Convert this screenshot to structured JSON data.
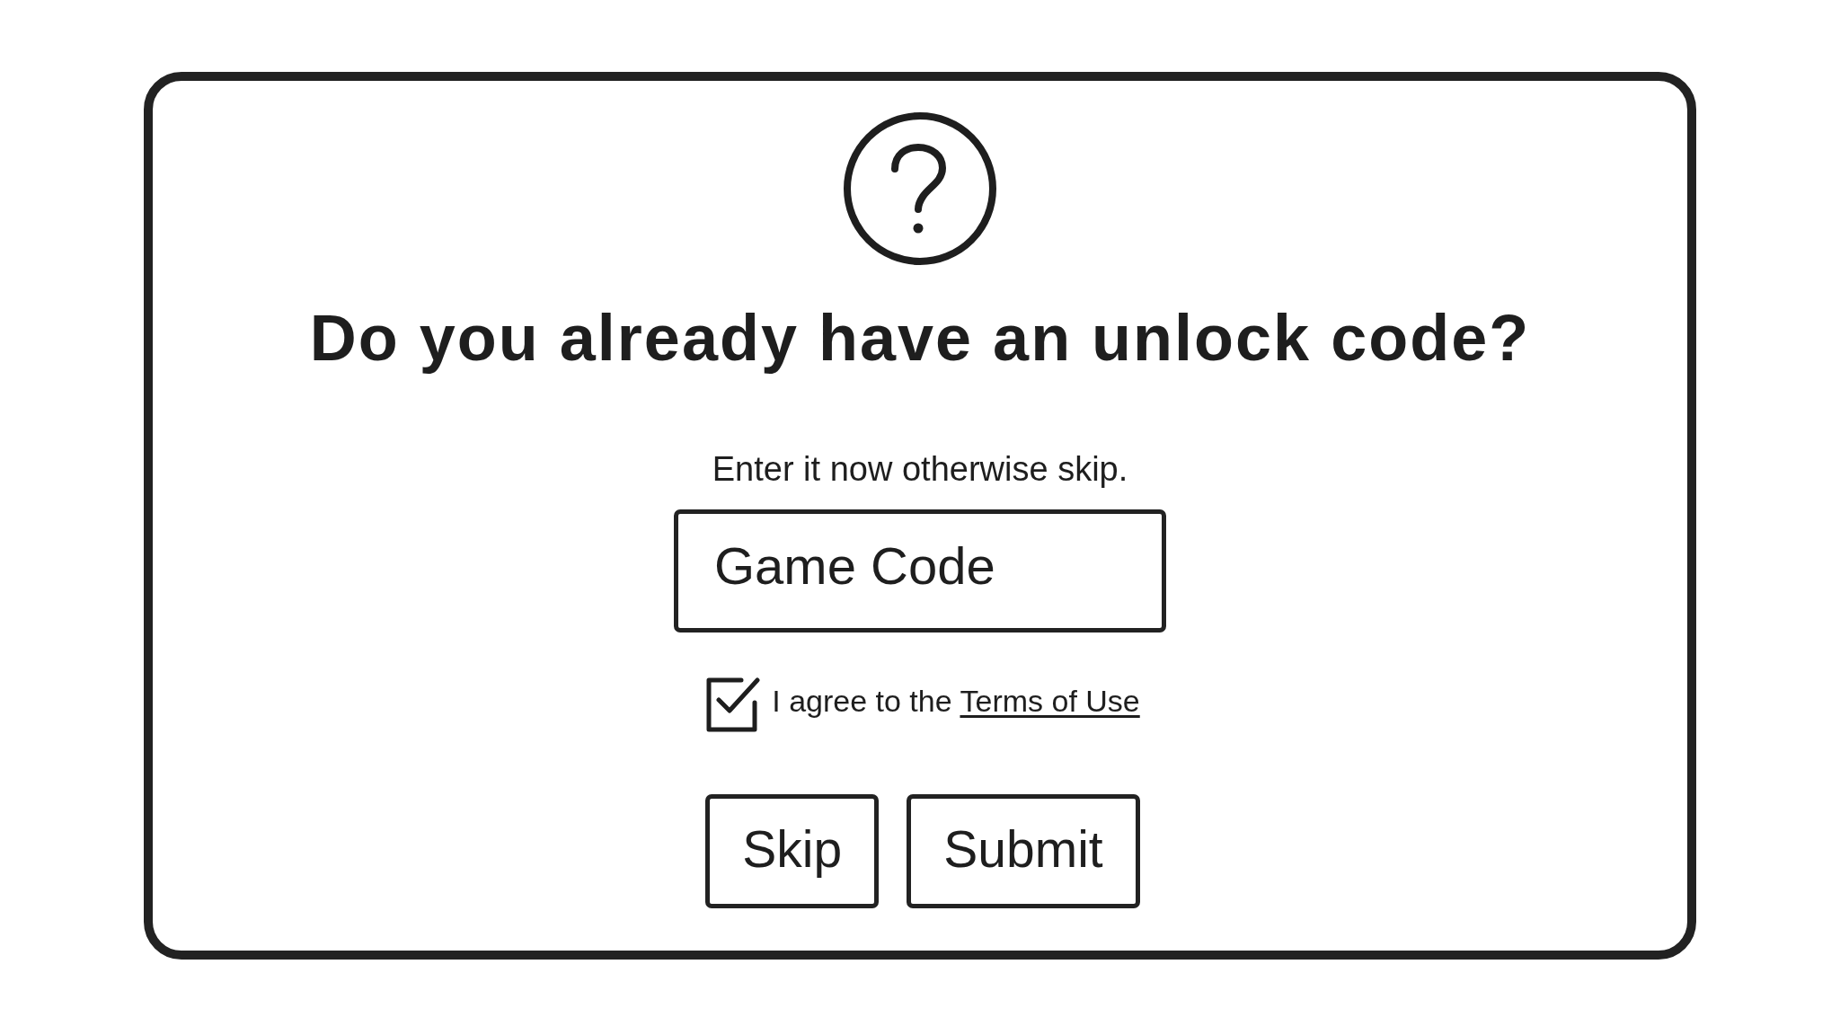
{
  "dialog": {
    "title": "Do you already have an unlock code?",
    "subtitle": "Enter it now otherwise skip.",
    "code_field": {
      "placeholder": "Game Code"
    },
    "agreement": {
      "checked": true,
      "text": "I agree to the",
      "link": "Terms of Use"
    },
    "buttons": [
      {
        "label": "Skip"
      },
      {
        "label": "Submit"
      }
    ]
  }
}
